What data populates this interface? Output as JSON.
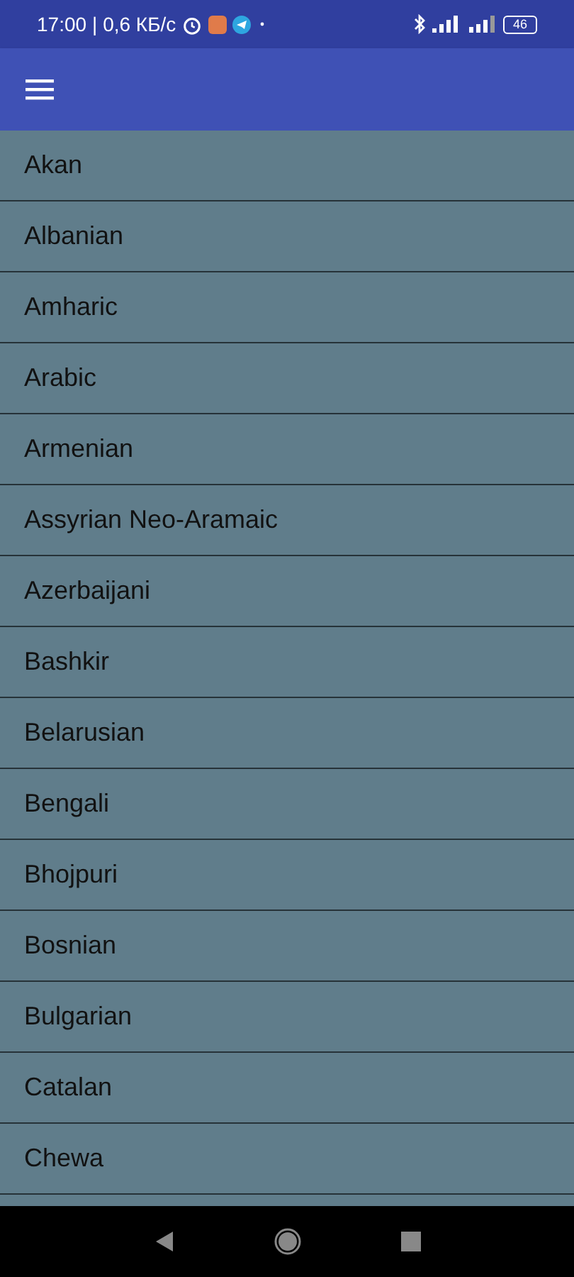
{
  "status_bar": {
    "time": "17:00",
    "speed": "| 0,6 КБ/с",
    "battery": "46"
  },
  "languages": [
    "Akan",
    "Albanian",
    "Amharic",
    "Arabic",
    "Armenian",
    "Assyrian Neo-Aramaic",
    "Azerbaijani",
    "Bashkir",
    "Belarusian",
    "Bengali",
    "Bhojpuri",
    "Bosnian",
    "Bulgarian",
    "Catalan",
    "Chewa"
  ]
}
